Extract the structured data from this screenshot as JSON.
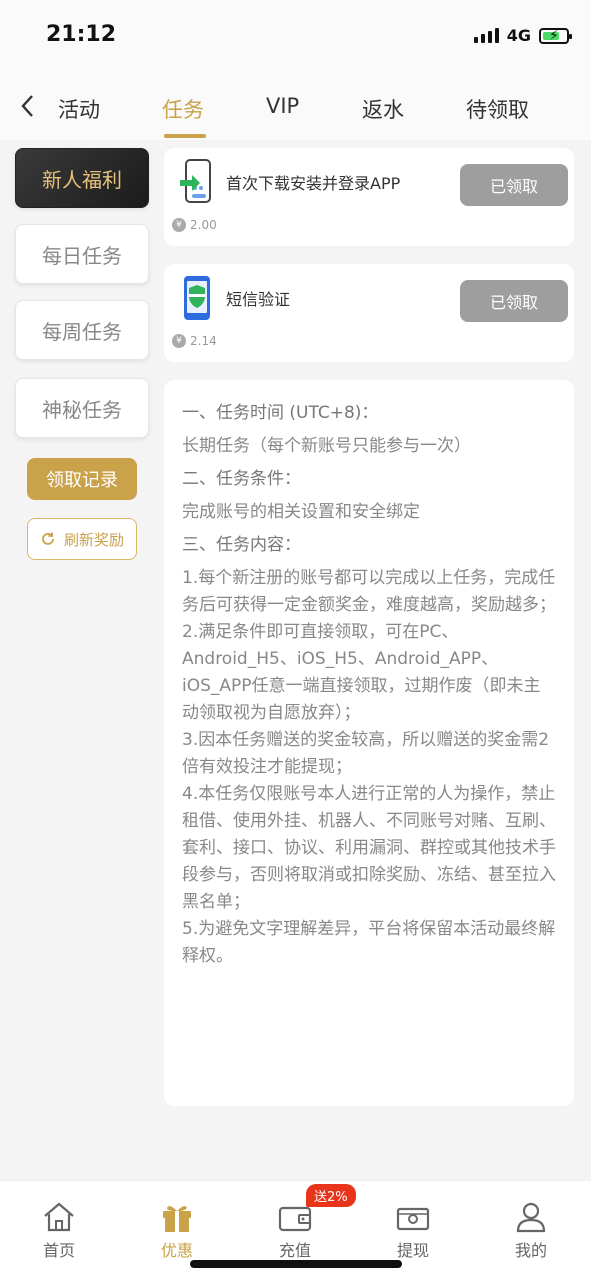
{
  "status": {
    "time": "21:12",
    "network": "4G"
  },
  "tabs": [
    {
      "label": "活动"
    },
    {
      "label": "任务"
    },
    {
      "label": "VIP"
    },
    {
      "label": "返水"
    },
    {
      "label": "待领取"
    }
  ],
  "active_tab": "任务",
  "side_menu": [
    {
      "label": "新人福利"
    },
    {
      "label": "每日任务"
    },
    {
      "label": "每周任务"
    },
    {
      "label": "神秘任务"
    }
  ],
  "record_button": "领取记录",
  "refresh_button": "刷新奖励",
  "tasks": [
    {
      "title": "首次下载安装并登录APP",
      "button": "已领取",
      "reward": "2.00",
      "icon": "app-download-icon"
    },
    {
      "title": "短信验证",
      "button": "已领取",
      "reward": "2.14",
      "icon": "shield-phone-icon"
    }
  ],
  "info": {
    "h1": "一、任务时间 (UTC+8)：",
    "p1": "长期任务（每个新账号只能参与一次）",
    "h2": "二、任务条件：",
    "p2": "完成账号的相关设置和安全绑定",
    "h3": "三、任务内容：",
    "items": [
      "1.每个新注册的账号都可以完成以上任务，完成任务后可获得一定金额奖金，难度越高，奖励越多；",
      "2.满足条件即可直接领取，可在PC、Android_H5、iOS_H5、Android_APP、iOS_APP任意一端直接领取，过期作废（即未主动领取视为自愿放弃）；",
      "3.因本任务赠送的奖金较高，所以赠送的奖金需2倍有效投注才能提现；",
      "4.本任务仅限账号本人进行正常的人为操作，禁止租借、使用外挂、机器人、不同账号对赌、互刷、套利、接口、协议、利用漏洞、群控或其他技术手段参与，否则将取消或扣除奖励、冻结、甚至拉入黑名单；",
      "5.为避免文字理解差异，平台将保留本活动最终解释权。"
    ]
  },
  "bottom_nav": [
    {
      "label": "首页",
      "icon": "home-icon"
    },
    {
      "label": "优惠",
      "icon": "gift-icon"
    },
    {
      "label": "充值",
      "icon": "wallet-icon"
    },
    {
      "label": "提现",
      "icon": "cash-icon"
    },
    {
      "label": "我的",
      "icon": "user-icon"
    }
  ],
  "promo_badge": "送2%",
  "colors": {
    "accent": "#c9a24a",
    "claimed": "#9e9e9e",
    "badge": "#e8341a"
  }
}
